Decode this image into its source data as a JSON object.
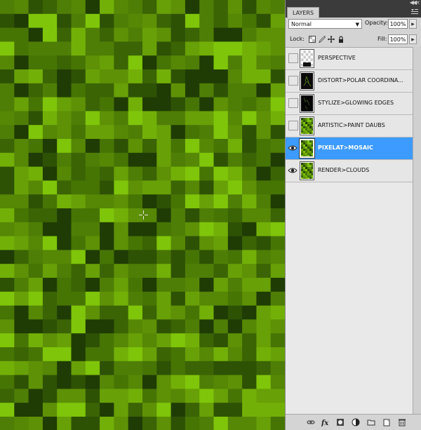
{
  "panel": {
    "tab_label": "LAYERS",
    "blend_mode": "Normal",
    "opacity_label": "Opacity:",
    "opacity_value": "100%",
    "lock_label": "Lock:",
    "fill_label": "Fill:",
    "fill_value": "100%"
  },
  "layers": [
    {
      "name": "PERSPECTIVE",
      "visible": false,
      "selected": false,
      "thumb": "transparent"
    },
    {
      "name": "DISTORT>POLAR COORDINA...",
      "visible": false,
      "selected": false,
      "thumb": "black-rays"
    },
    {
      "name": "STYLIZE>GLOWING EDGES",
      "visible": false,
      "selected": false,
      "thumb": "black-edges"
    },
    {
      "name": "ARTISTIC>PAINT DAUBS",
      "visible": false,
      "selected": false,
      "thumb": "green"
    },
    {
      "name": "PIXELAT>MOSAIC",
      "visible": true,
      "selected": true,
      "thumb": "green"
    },
    {
      "name": "RENDER>CLOUDS",
      "visible": true,
      "selected": false,
      "thumb": "green"
    }
  ],
  "colors": {
    "selection": "#3d9bff",
    "mosaic_palette": [
      "#1f3c04",
      "#2e5204",
      "#3b6404",
      "#477504",
      "#4f7e06",
      "#568705",
      "#5e9106",
      "#68a007",
      "#72b008",
      "#7fc50a"
    ]
  },
  "icons": {
    "lock": [
      "lock-transparent-icon",
      "lock-image-icon",
      "lock-position-icon",
      "lock-all-icon"
    ],
    "bottom": [
      "link-layers-icon",
      "fx-icon",
      "add-mask-icon",
      "adjustment-layer-icon",
      "new-group-icon",
      "new-layer-icon",
      "delete-layer-icon"
    ]
  }
}
